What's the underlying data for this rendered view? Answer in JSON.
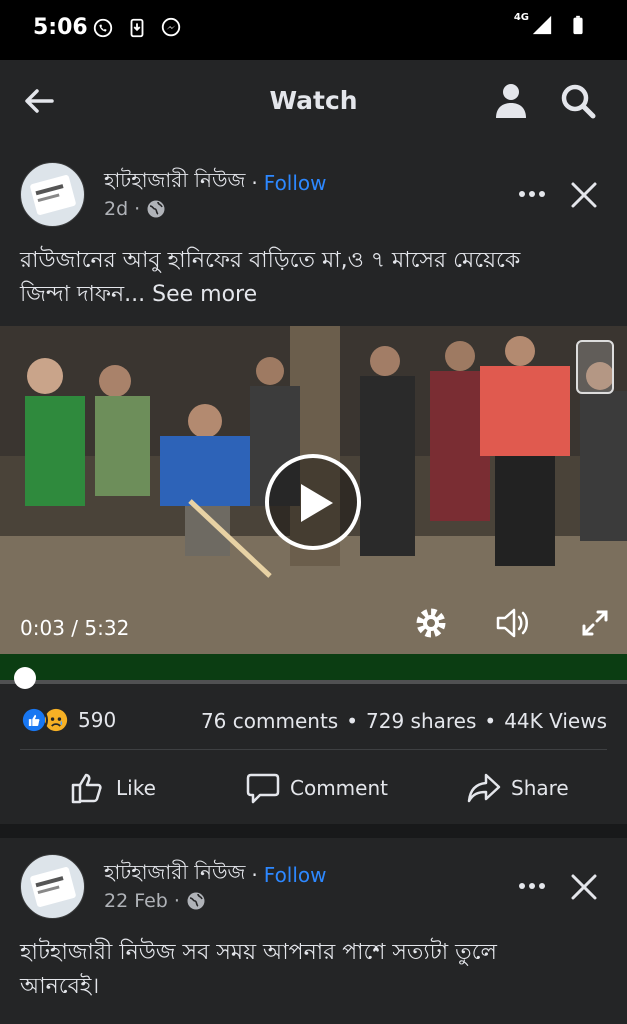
{
  "status_bar": {
    "time": "5:06",
    "network": "4G"
  },
  "app_bar": {
    "title": "Watch"
  },
  "post1": {
    "page_name": "হাটহাজারী নিউজ",
    "separator": "·",
    "follow_label": "Follow",
    "time": "2d",
    "meta_dot": "·",
    "text_line1": "রাউজানের আবু হানিফের  বাড়িতে   মা,ও ৭ মাসের মেয়েকে",
    "text_line2": "জিন্দা দাফন...",
    "see_more": "See more",
    "video": {
      "current_time": "0:03",
      "time_separator": "/",
      "duration": "5:32",
      "progress": 0.009
    },
    "reaction_count": "590",
    "comments": "76 comments",
    "dot": "•",
    "shares": "729 shares",
    "views": "44K Views",
    "actions": {
      "like": "Like",
      "comment": "Comment",
      "share": "Share"
    },
    "colors": {
      "follow": "#2d88ff",
      "like_reaction": "#1877f2",
      "sad_reaction": "#f7b125"
    }
  },
  "post2": {
    "page_name": "হাটহাজারী নিউজ",
    "separator": "·",
    "follow_label": "Follow",
    "time": "22 Feb",
    "meta_dot": "·",
    "text_line1": "হাটহাজারী নিউজ সব সময় আপনার পাশে সত্যটা তুলে",
    "text_line2": "আনবেই।"
  }
}
